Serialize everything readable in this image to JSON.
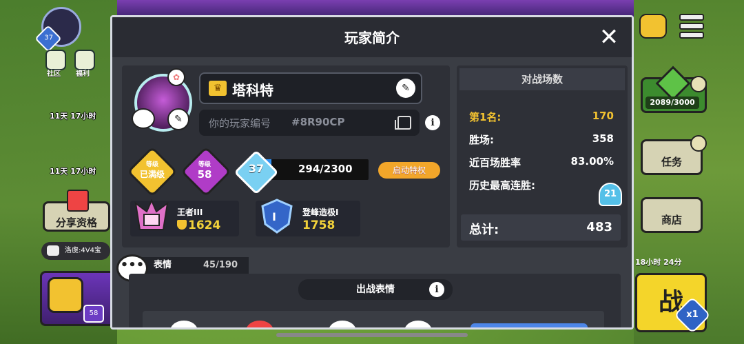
{
  "left_side": {
    "player_level": "37",
    "community_label": "社区",
    "welfare_label": "福利",
    "timer_1": "11天 17小时",
    "timer_2": "11天 17小时",
    "share_label": "分享资格",
    "chat_preview": "洛虞:4V4宝",
    "chest_count": "58"
  },
  "right_side": {
    "trophy_road": "2089/3000",
    "quests_label": "任务",
    "shop_label": "商店",
    "event_timer": "18小时 24分",
    "battle_label": "战",
    "multiplier": "x1"
  },
  "modal": {
    "title": "玩家简介",
    "close_symbol": "✕"
  },
  "profile": {
    "name": "塔科特",
    "id_label": "你的玩家编号",
    "id_value": "#8R90CP",
    "badge_max_label": "等级",
    "badge_max_value": "已满级",
    "badge_level_label": "等级",
    "badge_level_value": "58",
    "xp_level": "37",
    "xp_text": "294/2300",
    "xp_progress": 0.128,
    "boost_label": "启动特权",
    "rank1_name": "王者III",
    "rank1_value": "1624",
    "rank2_name": "登峰造极I",
    "rank2_value": "1758",
    "rank2_icon_num": "I"
  },
  "stats": {
    "header": "对战场数",
    "rows": [
      {
        "label": "第1名:",
        "value": "170"
      },
      {
        "label": "胜场:",
        "value": "358"
      },
      {
        "label": "近百场胜率",
        "value": "83.00%"
      },
      {
        "label": "历史最高连胜:",
        "value": ""
      }
    ],
    "streak_badge": "21",
    "total_label": "总计:",
    "total_value": "483"
  },
  "emotes": {
    "tab_label": "表情",
    "tab_count": "45/190",
    "equip_label": "出战表情"
  },
  "colors": {
    "modal_bg": "#2a2c33",
    "gold": "#f2c230",
    "accent_blue": "#2f8ff0"
  }
}
